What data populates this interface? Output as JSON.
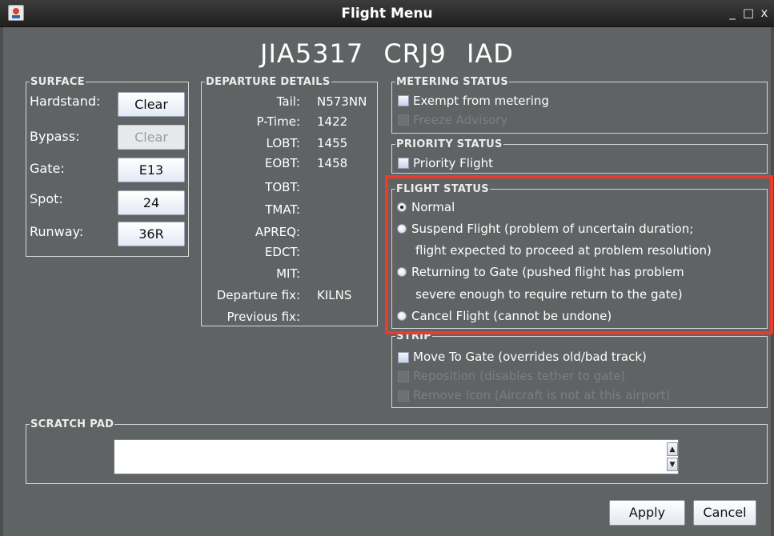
{
  "window": {
    "title": "Flight Menu",
    "minimize_glyph": "_",
    "maximize_glyph": "□",
    "close_glyph": "x",
    "app_icon": "java-coffee-cup-icon"
  },
  "header": {
    "callsign": "JIA5317",
    "aircraft_type": "CRJ9",
    "airport": "IAD"
  },
  "surface": {
    "legend": "SURFACE",
    "rows": [
      {
        "label": "Hardstand:",
        "value": "Clear",
        "enabled": true
      },
      {
        "label": "Bypass:",
        "value": "Clear",
        "enabled": false
      },
      {
        "label": "Gate:",
        "value": "E13",
        "enabled": true
      },
      {
        "label": "Spot:",
        "value": "24",
        "enabled": true
      },
      {
        "label": "Runway:",
        "value": "36R",
        "enabled": true
      }
    ]
  },
  "departure": {
    "legend": "DEPARTURE DETAILS",
    "rows": [
      {
        "label": "Tail:",
        "value": "N573NN"
      },
      {
        "label": "P-Time:",
        "value": "1422"
      },
      {
        "label": "LOBT:",
        "value": "1455"
      },
      {
        "label": "EOBT:",
        "value": "1458"
      },
      {
        "label": "TOBT:",
        "value": ""
      },
      {
        "label": "TMAT:",
        "value": ""
      },
      {
        "label": "APREQ:",
        "value": ""
      },
      {
        "label": "EDCT:",
        "value": ""
      },
      {
        "label": "MIT:",
        "value": ""
      },
      {
        "label": "Departure fix:",
        "value": "KILNS"
      },
      {
        "label": "Previous fix:",
        "value": ""
      }
    ]
  },
  "metering": {
    "legend": "METERING STATUS",
    "exempt_label": "Exempt from metering",
    "freeze_label": "Freeze Advisory"
  },
  "priority": {
    "legend": "PRIORITY STATUS",
    "priority_label": "Priority Flight"
  },
  "flight_status": {
    "legend": "FLIGHT STATUS",
    "selected": "Normal",
    "normal": "Normal",
    "suspend_line1": "Suspend Flight (problem of uncertain duration;",
    "suspend_line2": "flight expected to proceed at problem resolution)",
    "return_line1": "Returning to Gate (pushed flight has problem",
    "return_line2": "severe enough to require return to the gate)",
    "cancel": "Cancel Flight (cannot be undone)",
    "highlight_color": "#ea3b2c"
  },
  "strip": {
    "legend": "STRIP",
    "move_label": "Move To Gate (overrides old/bad track)",
    "reposition_label": "Reposition (disables tether to gate)",
    "remove_label": "Remove Icon (Aircraft is not at this airport)"
  },
  "scratch": {
    "legend": "SCRATCH PAD",
    "value": "",
    "scroll_up_glyph": "▲",
    "scroll_down_glyph": "▼"
  },
  "buttons": {
    "apply": "Apply",
    "cancel": "Cancel"
  },
  "colors": {
    "background": "#5f6364",
    "titlebar": "#2b2b2b"
  }
}
